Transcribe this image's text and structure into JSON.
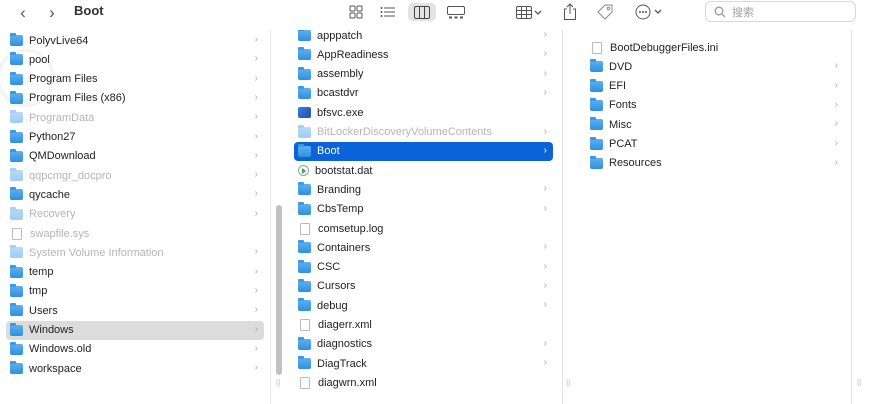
{
  "toolbar": {
    "back_glyph": "‹",
    "forward_glyph": "›",
    "title": "Boot",
    "view_icons_glyph": "⊞",
    "view_list_glyph": "☰",
    "view_columns_glyph": "◫",
    "view_gallery_glyph": "▭",
    "group_glyph": "⊞⌄",
    "share_glyph": "⇧",
    "tag_glyph": "◇",
    "more_glyph": "⊙⌄",
    "search_icon_glyph": "⌕",
    "search_placeholder": "搜索"
  },
  "column1": [
    {
      "name": "PolyvLive64",
      "type": "folder",
      "dim": false,
      "chevron": true
    },
    {
      "name": "pool",
      "type": "folder",
      "dim": false,
      "chevron": true
    },
    {
      "name": "Program Files",
      "type": "folder",
      "dim": false,
      "chevron": true
    },
    {
      "name": "Program Files (x86)",
      "type": "folder",
      "dim": false,
      "chevron": true
    },
    {
      "name": "ProgramData",
      "type": "folder",
      "dim": true,
      "chevron": true
    },
    {
      "name": "Python27",
      "type": "folder",
      "dim": false,
      "chevron": true
    },
    {
      "name": "QMDownload",
      "type": "folder",
      "dim": false,
      "chevron": true
    },
    {
      "name": "qqpcmgr_docpro",
      "type": "folder",
      "dim": true,
      "chevron": true
    },
    {
      "name": "qycache",
      "type": "folder",
      "dim": false,
      "chevron": true
    },
    {
      "name": "Recovery",
      "type": "folder",
      "dim": true,
      "chevron": true
    },
    {
      "name": "swapfile.sys",
      "type": "file",
      "dim": true,
      "chevron": false
    },
    {
      "name": "System Volume Information",
      "type": "folder",
      "dim": true,
      "chevron": true
    },
    {
      "name": "temp",
      "type": "folder",
      "dim": false,
      "chevron": true
    },
    {
      "name": "tmp",
      "type": "folder",
      "dim": false,
      "chevron": true
    },
    {
      "name": "Users",
      "type": "folder",
      "dim": false,
      "chevron": true
    },
    {
      "name": "Windows",
      "type": "folder",
      "dim": false,
      "chevron": true,
      "selected": "gray"
    },
    {
      "name": "Windows.old",
      "type": "folder",
      "dim": false,
      "chevron": true
    },
    {
      "name": "workspace",
      "type": "folder",
      "dim": false,
      "chevron": true
    }
  ],
  "column2": [
    {
      "name": "apppatch",
      "type": "folder",
      "dim": false,
      "chevron": true
    },
    {
      "name": "AppReadiness",
      "type": "folder",
      "dim": false,
      "chevron": true
    },
    {
      "name": "assembly",
      "type": "folder",
      "dim": false,
      "chevron": true
    },
    {
      "name": "bcastdvr",
      "type": "folder",
      "dim": false,
      "chevron": true
    },
    {
      "name": "bfsvc.exe",
      "type": "exe",
      "dim": false,
      "chevron": false
    },
    {
      "name": "BitLockerDiscoveryVolumeContents",
      "type": "folder",
      "dim": true,
      "chevron": true
    },
    {
      "name": "Boot",
      "type": "folder",
      "dim": false,
      "chevron": true,
      "selected": "blue"
    },
    {
      "name": "bootstat.dat",
      "type": "dat",
      "dim": false,
      "chevron": false
    },
    {
      "name": "Branding",
      "type": "folder",
      "dim": false,
      "chevron": true
    },
    {
      "name": "CbsTemp",
      "type": "folder",
      "dim": false,
      "chevron": true
    },
    {
      "name": "comsetup.log",
      "type": "file",
      "dim": false,
      "chevron": false
    },
    {
      "name": "Containers",
      "type": "folder",
      "dim": false,
      "chevron": true
    },
    {
      "name": "CSC",
      "type": "folder",
      "dim": false,
      "chevron": true
    },
    {
      "name": "Cursors",
      "type": "folder",
      "dim": false,
      "chevron": true
    },
    {
      "name": "debug",
      "type": "folder",
      "dim": false,
      "chevron": true
    },
    {
      "name": "diagerr.xml",
      "type": "file",
      "dim": false,
      "chevron": false
    },
    {
      "name": "diagnostics",
      "type": "folder",
      "dim": false,
      "chevron": true
    },
    {
      "name": "DiagTrack",
      "type": "folder",
      "dim": false,
      "chevron": true
    },
    {
      "name": "diagwrn.xml",
      "type": "file",
      "dim": false,
      "chevron": false
    }
  ],
  "column3": [
    {
      "name": "BootDebuggerFiles.ini",
      "type": "file",
      "dim": false,
      "chevron": false
    },
    {
      "name": "DVD",
      "type": "folder",
      "dim": false,
      "chevron": true
    },
    {
      "name": "EFI",
      "type": "folder",
      "dim": false,
      "chevron": true
    },
    {
      "name": "Fonts",
      "type": "folder",
      "dim": false,
      "chevron": true
    },
    {
      "name": "Misc",
      "type": "folder",
      "dim": false,
      "chevron": true
    },
    {
      "name": "PCAT",
      "type": "folder",
      "dim": false,
      "chevron": true
    },
    {
      "name": "Resources",
      "type": "folder",
      "dim": false,
      "chevron": true
    }
  ],
  "chevron_glyph": "›",
  "colors": {
    "selection_blue": "#0a63d8",
    "selection_gray": "#dcdcdc",
    "folder_blue": "#3c98e4"
  }
}
